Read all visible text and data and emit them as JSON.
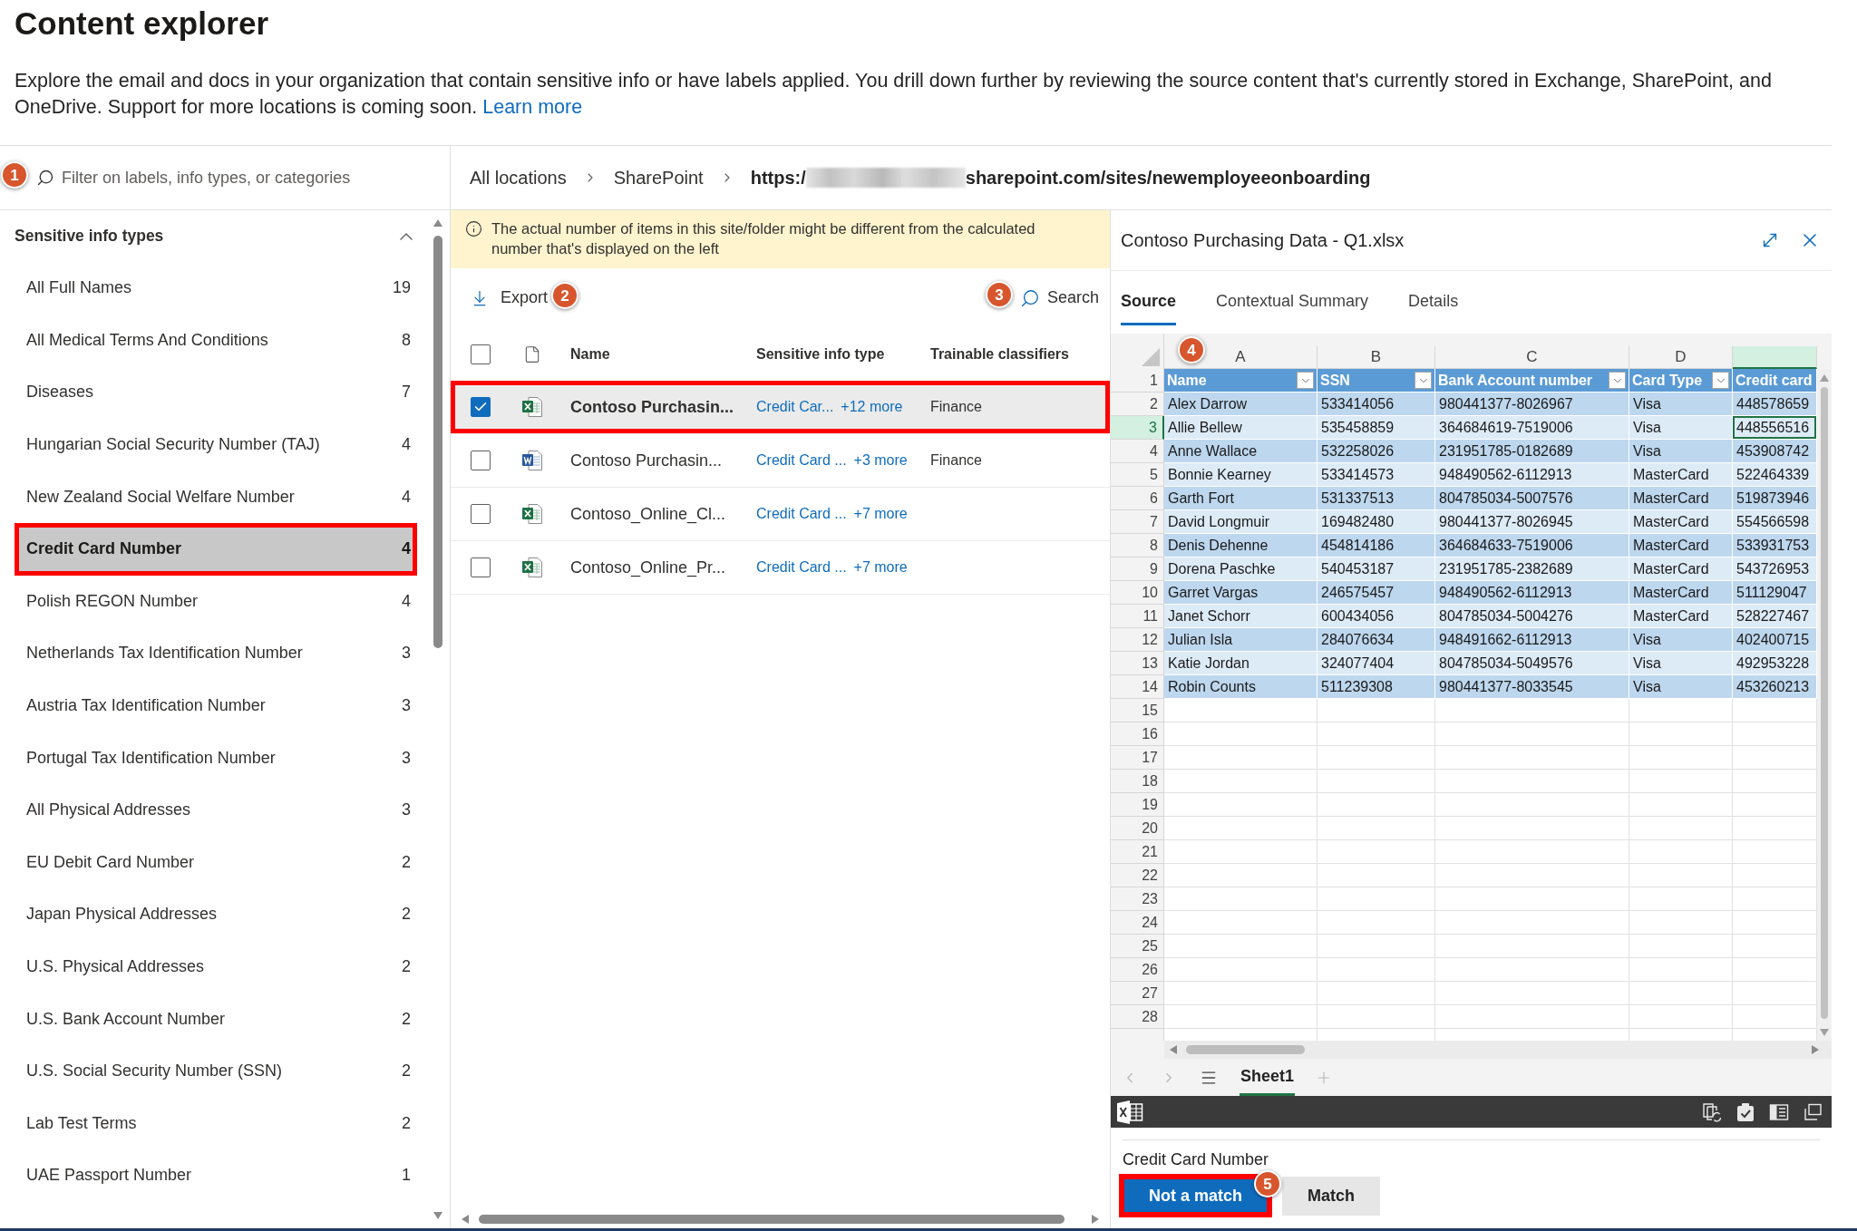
{
  "page": {
    "title": "Content explorer",
    "description": "Explore the email and docs in your organization that contain sensitive info or have labels applied. You drill down further by reviewing the source content that's currently stored in Exchange, SharePoint, and OneDrive. Support for more locations is coming soon.",
    "learn_more": "Learn more"
  },
  "filter": {
    "placeholder": "Filter on labels, info types, or categories",
    "callout": "1"
  },
  "breadcrumb": {
    "items": [
      "All locations",
      "SharePoint"
    ],
    "url_start": "https:/",
    "url_end": "sharepoint.com/sites/newemployeeonboarding"
  },
  "sidebar": {
    "title": "Sensitive info types",
    "expanded": true,
    "items": [
      {
        "label": "All Full Names",
        "count": "19",
        "selected": false,
        "highlighted": false
      },
      {
        "label": "All Medical Terms And Conditions",
        "count": "8",
        "selected": false,
        "highlighted": false
      },
      {
        "label": "Diseases",
        "count": "7",
        "selected": false,
        "highlighted": false
      },
      {
        "label": "Hungarian Social Security Number (TAJ)",
        "count": "4",
        "selected": false,
        "highlighted": false
      },
      {
        "label": "New Zealand Social Welfare Number",
        "count": "4",
        "selected": false,
        "highlighted": false
      },
      {
        "label": "Credit Card Number",
        "count": "4",
        "selected": true,
        "highlighted": true
      },
      {
        "label": "Polish REGON Number",
        "count": "4",
        "selected": false,
        "highlighted": false
      },
      {
        "label": "Netherlands Tax Identification Number",
        "count": "3",
        "selected": false,
        "highlighted": false
      },
      {
        "label": "Austria Tax Identification Number",
        "count": "3",
        "selected": false,
        "highlighted": false
      },
      {
        "label": "Portugal Tax Identification Number",
        "count": "3",
        "selected": false,
        "highlighted": false
      },
      {
        "label": "All Physical Addresses",
        "count": "3",
        "selected": false,
        "highlighted": false
      },
      {
        "label": "EU Debit Card Number",
        "count": "2",
        "selected": false,
        "highlighted": false
      },
      {
        "label": "Japan Physical Addresses",
        "count": "2",
        "selected": false,
        "highlighted": false
      },
      {
        "label": "U.S. Physical Addresses",
        "count": "2",
        "selected": false,
        "highlighted": false
      },
      {
        "label": "U.S. Bank Account Number",
        "count": "2",
        "selected": false,
        "highlighted": false
      },
      {
        "label": "U.S. Social Security Number (SSN)",
        "count": "2",
        "selected": false,
        "highlighted": false
      },
      {
        "label": "Lab Test Terms",
        "count": "2",
        "selected": false,
        "highlighted": false
      },
      {
        "label": "UAE Passport Number",
        "count": "1",
        "selected": false,
        "highlighted": false
      }
    ]
  },
  "notice": {
    "text": "The actual number of items in this site/folder might be different from the calculated number that's displayed on the left"
  },
  "toolbar": {
    "export": {
      "label": "Export",
      "callout": "2"
    },
    "search": {
      "label": "Search",
      "callout": "3"
    }
  },
  "file_table": {
    "select_all_checked": false,
    "columns": [
      "Name",
      "Sensitive info type",
      "Trainable classifiers"
    ],
    "rows": [
      {
        "kind": "excel",
        "name": "Contoso Purchasin...",
        "info_type": "Credit Car...",
        "more": "+12 more",
        "classifier": "Finance",
        "checked": true,
        "selected": true,
        "highlighted": true
      },
      {
        "kind": "word",
        "name": "Contoso Purchasin...",
        "info_type": "Credit Card ...",
        "more": "+3 more",
        "classifier": "Finance",
        "checked": false,
        "selected": false,
        "highlighted": false
      },
      {
        "kind": "excel",
        "name": "Contoso_Online_Cl...",
        "info_type": "Credit Card ...",
        "more": "+7 more",
        "checked": false,
        "selected": false,
        "highlighted": false
      },
      {
        "kind": "excel",
        "name": "Contoso_Online_Pr...",
        "info_type": "Credit Card ...",
        "more": "+7 more",
        "checked": false,
        "selected": false,
        "highlighted": false
      }
    ]
  },
  "preview": {
    "title": "Contoso Purchasing Data - Q1.xlsx",
    "tabs": [
      {
        "label": "Source",
        "selected": true
      },
      {
        "label": "Contextual Summary",
        "selected": false
      },
      {
        "label": "Details",
        "selected": false
      }
    ],
    "sheet": {
      "callout": "4",
      "columns": [
        {
          "letter": "A",
          "selected": false
        },
        {
          "letter": "B",
          "selected": false
        },
        {
          "letter": "C",
          "selected": false
        },
        {
          "letter": "D",
          "selected": false
        },
        {
          "selected": true
        }
      ],
      "header_row": {
        "number": "1",
        "cells": [
          {
            "label": "Name",
            "filter": true
          },
          {
            "label": "SSN",
            "filter": true
          },
          {
            "label": "Bank Account number",
            "filter": true
          },
          {
            "label": "Card Type",
            "filter": true
          },
          {
            "label": "Credit card",
            "filter": false
          }
        ]
      },
      "rows": [
        {
          "number": "2",
          "selected": false,
          "cells": [
            "Alex Darrow",
            "533414056",
            "980441377-8026967",
            "Visa",
            "448578659"
          ]
        },
        {
          "number": "3",
          "selected": true,
          "cells": [
            "Allie Bellew",
            "535458859",
            "364684619-7519006",
            "Visa",
            "448556516"
          ]
        },
        {
          "number": "4",
          "selected": false,
          "cells": [
            "Anne Wallace",
            "532258026",
            "231951785-0182689",
            "Visa",
            "453908742"
          ]
        },
        {
          "number": "5",
          "selected": false,
          "cells": [
            "Bonnie Kearney",
            "533414573",
            "948490562-6112913",
            "MasterCard",
            "522464339"
          ]
        },
        {
          "number": "6",
          "selected": false,
          "cells": [
            "Garth Fort",
            "531337513",
            "804785034-5007576",
            "MasterCard",
            "519873946"
          ]
        },
        {
          "number": "7",
          "selected": false,
          "cells": [
            "David Longmuir",
            "169482480",
            "980441377-8026945",
            "MasterCard",
            "554566598"
          ]
        },
        {
          "number": "8",
          "selected": false,
          "cells": [
            "Denis Dehenne",
            "454814186",
            "364684633-7519006",
            "MasterCard",
            "533931753"
          ]
        },
        {
          "number": "9",
          "selected": false,
          "cells": [
            "Dorena Paschke",
            "540453187",
            "231951785-2382689",
            "MasterCard",
            "543726953"
          ]
        },
        {
          "number": "10",
          "selected": false,
          "cells": [
            "Garret Vargas",
            "246575457",
            "948490562-6112913",
            "MasterCard",
            "511129047"
          ]
        },
        {
          "number": "11",
          "selected": false,
          "cells": [
            "Janet Schorr",
            "600434056",
            "804785034-5004276",
            "MasterCard",
            "528227467"
          ]
        },
        {
          "number": "12",
          "selected": false,
          "cells": [
            "Julian Isla",
            "284076634",
            "948491662-6112913",
            "Visa",
            "402400715"
          ]
        },
        {
          "number": "13",
          "selected": false,
          "cells": [
            "Katie Jordan",
            "324077404",
            "804785034-5049576",
            "Visa",
            "492953228"
          ]
        },
        {
          "number": "14",
          "selected": false,
          "cells": [
            "Robin Counts",
            "511239308",
            "980441377-8033545",
            "Visa",
            "453260213"
          ]
        }
      ],
      "empty_rows": [
        "15",
        "16",
        "17",
        "18",
        "19",
        "20",
        "21",
        "22",
        "23",
        "24",
        "25",
        "26",
        "27",
        "28"
      ],
      "sheet_tabs": [
        {
          "label": "Sheet1",
          "selected": true
        }
      ]
    }
  },
  "review": {
    "label": "Credit Card Number",
    "callout": "5",
    "buttons": [
      {
        "label": "Not a match",
        "kind": "primary",
        "highlighted": true
      },
      {
        "label": "Match",
        "kind": "secondary",
        "highlighted": false
      }
    ]
  }
}
